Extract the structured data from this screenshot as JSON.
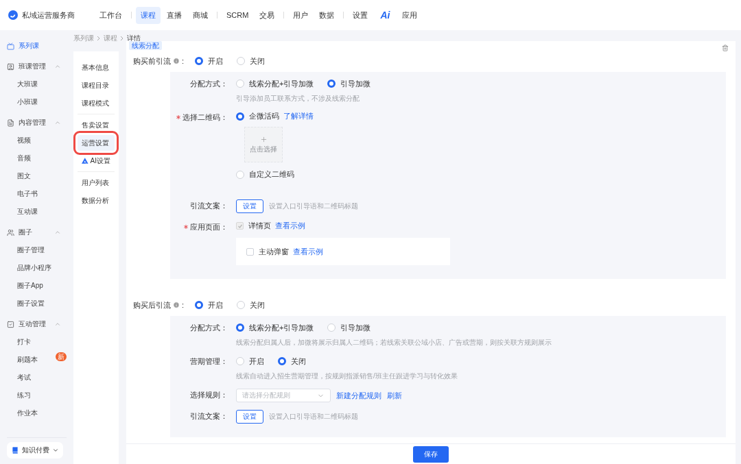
{
  "app": {
    "name": "私域运营服务商"
  },
  "top_nav": [
    [
      {
        "label": "工作台",
        "kind": "text",
        "selected": false
      }
    ],
    [
      {
        "label": "课程",
        "kind": "text",
        "selected": true
      },
      {
        "label": "直播",
        "kind": "text",
        "selected": false
      },
      {
        "label": "商城",
        "kind": "text",
        "selected": false
      }
    ],
    [
      {
        "label": "SCRM",
        "kind": "text",
        "selected": false
      },
      {
        "label": "交易",
        "kind": "text",
        "selected": false
      }
    ],
    [
      {
        "label": "用户",
        "kind": "text",
        "selected": false
      },
      {
        "label": "数据",
        "kind": "text",
        "selected": false
      }
    ],
    [
      {
        "label": "设置",
        "kind": "text",
        "selected": false
      },
      {
        "label": "Ai",
        "kind": "ai",
        "selected": false
      },
      {
        "label": "应用",
        "kind": "text",
        "selected": false
      }
    ]
  ],
  "sidebar": {
    "items": [
      {
        "label": "系列课",
        "kind": "link",
        "selected": true
      },
      {
        "label": "班课管理",
        "kind": "group",
        "expanded": true,
        "children": [
          {
            "label": "大班课",
            "selected": false
          },
          {
            "label": "小班课",
            "selected": false
          }
        ]
      },
      {
        "label": "内容管理",
        "kind": "group",
        "expanded": true,
        "children": [
          {
            "label": "视频",
            "selected": false
          },
          {
            "label": "音频",
            "selected": false
          },
          {
            "label": "图文",
            "selected": false
          },
          {
            "label": "电子书",
            "selected": false
          },
          {
            "label": "互动课",
            "selected": false
          }
        ]
      },
      {
        "label": "圈子",
        "kind": "group",
        "expanded": true,
        "children": [
          {
            "label": "圈子管理",
            "selected": false
          },
          {
            "label": "品牌小程序",
            "selected": false
          },
          {
            "label": "圈子App",
            "selected": false
          },
          {
            "label": "圈子设置",
            "selected": false
          }
        ]
      },
      {
        "label": "互动管理",
        "kind": "group",
        "expanded": true,
        "children": [
          {
            "label": "打卡",
            "selected": false
          },
          {
            "label": "刷题本",
            "selected": false,
            "badge": "新"
          },
          {
            "label": "考试",
            "selected": false
          },
          {
            "label": "练习",
            "selected": false
          },
          {
            "label": "作业本",
            "selected": false
          }
        ]
      }
    ],
    "footer": {
      "label": "知识付费"
    }
  },
  "breadcrumb": [
    "系列课",
    "课程",
    "详情"
  ],
  "sub_nav": {
    "groups": [
      [
        {
          "label": "基本信息",
          "kind": "text",
          "selected": false,
          "highlighted": false
        },
        {
          "label": "课程目录",
          "kind": "text",
          "selected": false,
          "highlighted": false
        },
        {
          "label": "课程模式",
          "kind": "text",
          "selected": false,
          "highlighted": false
        }
      ],
      [
        {
          "label": "售卖设置",
          "kind": "text",
          "selected": false,
          "highlighted": false
        },
        {
          "label": "运营设置",
          "kind": "text",
          "selected": true,
          "highlighted": true
        },
        {
          "label": "AI设置",
          "kind": "ai",
          "selected": false,
          "highlighted": false
        }
      ],
      [
        {
          "label": "用户列表",
          "kind": "text",
          "selected": false,
          "highlighted": false
        },
        {
          "label": "数据分析",
          "kind": "text",
          "selected": false,
          "highlighted": false
        }
      ]
    ]
  },
  "card": {
    "tag": "线索分配",
    "sections": [
      {
        "label": "购买前引流",
        "suffix": ":",
        "options": [
          {
            "label": "开启",
            "selected": true
          },
          {
            "label": "关闭",
            "selected": false
          }
        ],
        "rows": [
          {
            "kind": "radio",
            "label": "分配方式：",
            "required": false,
            "options": [
              {
                "label": "线索分配+引导加微",
                "selected": false
              },
              {
                "label": "引导加微",
                "selected": true
              }
            ],
            "hint": "引导添加员工联系方式，不涉及线索分配"
          },
          {
            "kind": "qrcode",
            "label": "选择二维码：",
            "required": true,
            "options": [
              {
                "label": "企微活码",
                "selected": true,
                "link": "了解详情"
              },
              {
                "label": "自定义二维码",
                "selected": false
              }
            ],
            "upload": "点击选择"
          },
          {
            "kind": "button",
            "label": "引流文案：",
            "required": false,
            "button": "设置",
            "hint": "设置入口引导语和二维码标题"
          },
          {
            "kind": "pages",
            "label": "应用页面：",
            "required": true,
            "main": {
              "label": "详情页",
              "checked": true,
              "disabled": true,
              "link": "查看示例"
            },
            "extra": {
              "label": "主动弹窗",
              "checked": false,
              "link": "查看示例"
            }
          }
        ]
      },
      {
        "label": "购买后引流",
        "suffix": ":",
        "options": [
          {
            "label": "开启",
            "selected": true
          },
          {
            "label": "关闭",
            "selected": false
          }
        ],
        "rows": [
          {
            "kind": "radio",
            "label": "分配方式：",
            "required": false,
            "options": [
              {
                "label": "线索分配+引导加微",
                "selected": true
              },
              {
                "label": "引导加微",
                "selected": false
              }
            ],
            "hint": "线索分配归属人后，加微将展示归属人二维码；若线索关联公域小店、广告或营期，则按关联方规则展示"
          },
          {
            "kind": "radio",
            "label": "营期管理：",
            "required": false,
            "options": [
              {
                "label": "开启",
                "selected": false
              },
              {
                "label": "关闭",
                "selected": true
              }
            ],
            "hint": "线索自动进入招生营期管理，按规则指派销售/班主任跟进学习与转化效果"
          },
          {
            "kind": "select",
            "label": "选择规则：",
            "required": false,
            "placeholder": "请选择分配规则",
            "links": [
              "新建分配规则",
              "刷新"
            ]
          },
          {
            "kind": "button",
            "label": "引流文案：",
            "required": false,
            "button": "设置",
            "hint": "设置入口引导语和二维码标题"
          }
        ]
      }
    ]
  },
  "footer": {
    "save": "保存"
  }
}
